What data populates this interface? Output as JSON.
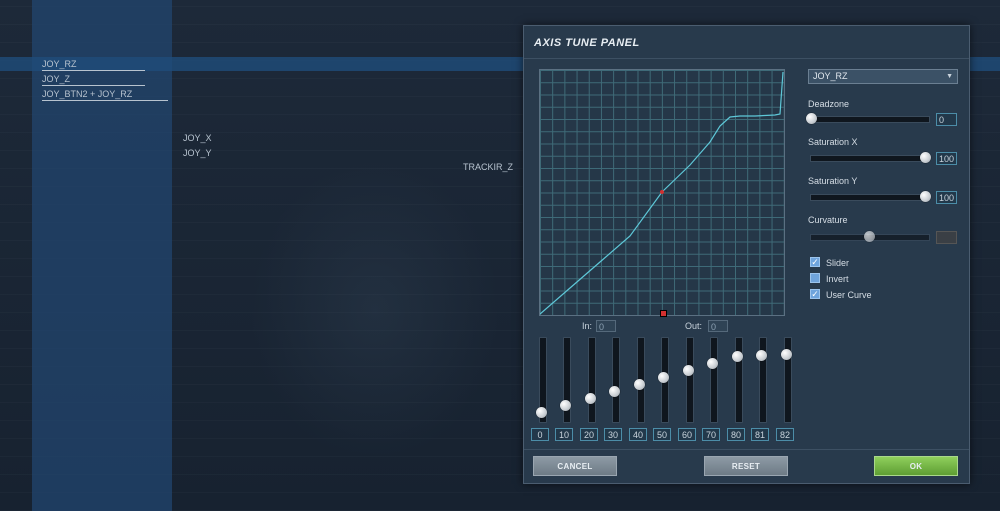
{
  "background": {
    "items_top": [
      "JOY_RZ",
      "JOY_Z",
      "JOY_BTN2 + JOY_RZ"
    ],
    "items_mid": [
      "JOY_X",
      "JOY_Y"
    ],
    "item_right": "TRACKIR_Z"
  },
  "panel": {
    "title": "AXIS TUNE PANEL",
    "in_label": "In:",
    "in_value": "0",
    "out_label": "Out:",
    "out_value": "0",
    "curve_sliders": [
      "0",
      "10",
      "20",
      "30",
      "40",
      "50",
      "60",
      "70",
      "80",
      "81",
      "82"
    ],
    "axis_select": "JOY_RZ",
    "deadzone": {
      "label": "Deadzone",
      "value": "0"
    },
    "saturation_x": {
      "label": "Saturation X",
      "value": "100"
    },
    "saturation_y": {
      "label": "Saturation Y",
      "value": "100"
    },
    "curvature": {
      "label": "Curvature",
      "value": ""
    },
    "options": [
      {
        "label": "Slider",
        "checked": true
      },
      {
        "label": "Invert",
        "checked": false
      },
      {
        "label": "User Curve",
        "checked": true
      }
    ],
    "buttons": {
      "cancel": "CANCEL",
      "reset": "RESET",
      "ok": "OK"
    }
  },
  "colors": {
    "accent": "#4c8da8",
    "ok": "#6fb143",
    "curve": "#5ec8d8"
  }
}
